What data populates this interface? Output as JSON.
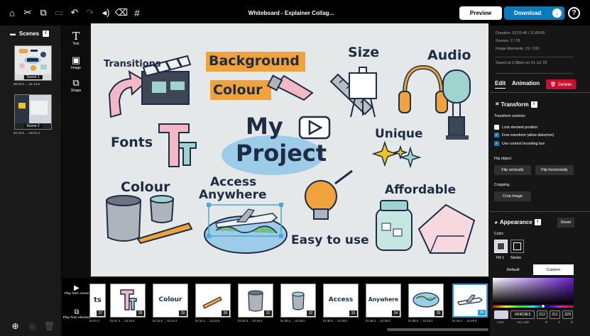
{
  "toolbar": {
    "icons": [
      "home-icon",
      "scissors-icon",
      "copy-icon",
      "paste-icon",
      "undo-icon",
      "redo-icon",
      "volume-icon",
      "eraser-icon",
      "grid-icon"
    ],
    "title": "Whiteboard - Explainer Collag...",
    "preview_label": "Preview",
    "download_label": "Download"
  },
  "scenes_panel": {
    "title": "Scenes",
    "scenes": [
      {
        "label": "Scene 1",
        "time": "00:00.0 → 01:43.5"
      },
      {
        "label": "Scene 2",
        "time": "01:43.5 → 02:01.4"
      }
    ]
  },
  "tools": [
    {
      "label": "Text",
      "icon": "text-tool-icon"
    },
    {
      "label": "Image",
      "icon": "image-tool-icon"
    },
    {
      "label": "Shape",
      "icon": "shape-tool-icon"
    }
  ],
  "canvas": {
    "words": {
      "transitions": "Transitions",
      "background": "Background",
      "colour_top": "Colour",
      "size": "Size",
      "audio": "Audio",
      "my": "My",
      "project": "Project",
      "fonts": "Fonts",
      "unique": "Unique",
      "colour": "Colour",
      "access": "Access",
      "anywhere": "Anywhere",
      "affordable": "Affordable",
      "easy": "Easy to use"
    }
  },
  "properties": {
    "duration": "Duration: 02:01:40 / 11:00:00",
    "scenes": "Scenes: 2 / 25",
    "image_elements": "Image Elements: 21 / 100",
    "saved": "Saved at 2:38pm on 01 Jul '22",
    "tab_edit": "Edit",
    "tab_animation": "Animation",
    "delete_label": "Delete",
    "transform_title": "Transform",
    "transform_controls": "Transform controls:",
    "checkboxes": [
      {
        "label": "Lock element position",
        "checked": false
      },
      {
        "label": "Free transform (allow distortion)",
        "checked": true
      },
      {
        "label": "Use content bounding box",
        "checked": true
      }
    ],
    "flip_label": "Flip object:",
    "flip_v": "Flip vertically",
    "flip_h": "Flip horizontally",
    "cropping_label": "Cropping:",
    "crop_image": "Crop image",
    "appearance_title": "Appearance",
    "reset_label": "Reset",
    "color_label": "Color:",
    "fill_label": "Fill 1",
    "stroke_label": "Stroke",
    "default_tab": "Default",
    "custom_tab": "Custom",
    "hex_value": "#D4D3E3",
    "r": "212",
    "g": "211",
    "b": "229",
    "col_lbl": "Color",
    "hex_lbl": "Hex code",
    "r_lbl": "R",
    "g_lbl": "G",
    "b_lbl": "B",
    "color_value": "#D4D3E3"
  },
  "timeline": {
    "play_scene": "Play from scene",
    "play_element": "Play from element",
    "thumbs": [
      {
        "num": "27",
        "text": "ts",
        "time": "01:07.4"
      },
      {
        "num": "28",
        "text": "",
        "time": "01:07.4 → 01:13.0"
      },
      {
        "num": "29",
        "text": "Colour",
        "time": "01:13.0 → 01:14.4"
      },
      {
        "num": "30",
        "text": "",
        "time": "01:14.4 → 01:22.9"
      },
      {
        "num": "31",
        "text": "",
        "time": "01:22.9 → 01:29.4"
      },
      {
        "num": "32",
        "text": "",
        "time": "01:29.4 → 01:35.0"
      },
      {
        "num": "33",
        "text": "Access",
        "time": "01:35.0 → 01:36.4"
      },
      {
        "num": "34",
        "text": "Anywhere",
        "time": "01:36.4 → 01:38.0"
      },
      {
        "num": "35",
        "text": "",
        "time": "01:38.0 → 01:43.4"
      },
      {
        "num": "36",
        "text": "",
        "time": "01:43.4 → 01:49.9"
      }
    ]
  },
  "colors": {
    "accent": "#0A7AC0",
    "delete": "#C8102E",
    "active_thumb": "#23A0E0",
    "canvas_bg": "#E4E8E8",
    "text_dark": "#1E2C44"
  }
}
